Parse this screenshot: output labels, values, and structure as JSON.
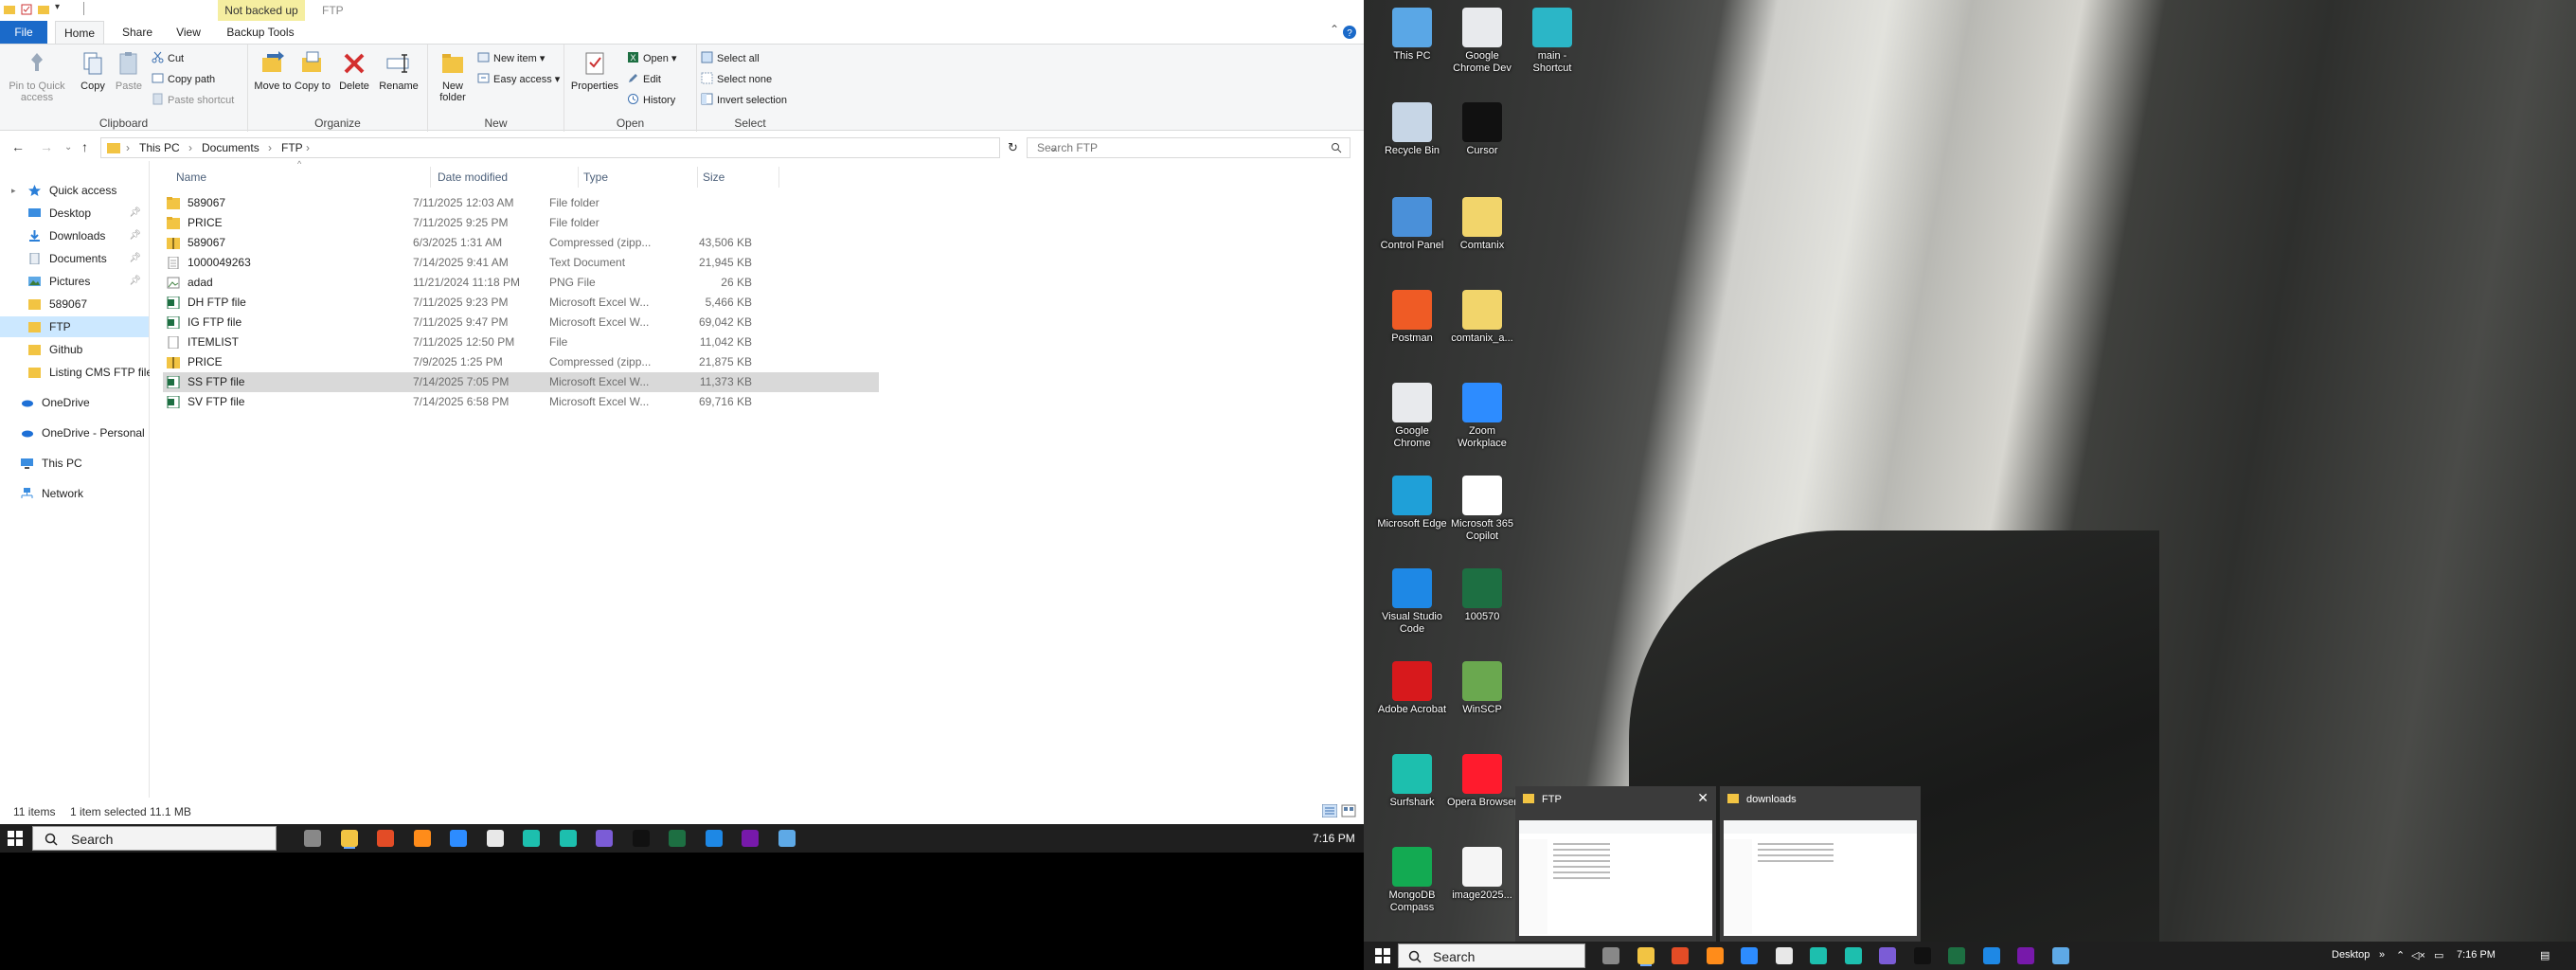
{
  "explorer": {
    "context_tab": "Not backed up",
    "title": "FTP",
    "tabs": {
      "file": "File",
      "home": "Home",
      "share": "Share",
      "view": "View",
      "backup": "Backup Tools"
    },
    "ribbon": {
      "clipboard": {
        "label": "Clipboard",
        "pin": "Pin to Quick access",
        "copy": "Copy",
        "paste": "Paste",
        "cut": "Cut",
        "copy_path": "Copy path",
        "paste_shortcut": "Paste shortcut"
      },
      "organize": {
        "label": "Organize",
        "move_to": "Move to",
        "copy_to": "Copy to",
        "delete": "Delete",
        "rename": "Rename"
      },
      "new": {
        "label": "New",
        "new_folder": "New folder",
        "new_item": "New item",
        "easy_access": "Easy access"
      },
      "open": {
        "label": "Open",
        "properties": "Properties",
        "open": "Open",
        "edit": "Edit",
        "history": "History"
      },
      "select": {
        "label": "Select",
        "select_all": "Select all",
        "select_none": "Select none",
        "invert": "Invert selection"
      }
    },
    "breadcrumb": [
      "This PC",
      "Documents",
      "FTP"
    ],
    "search_placeholder": "Search FTP",
    "nav": {
      "quick_access": "Quick access",
      "items": [
        "Desktop",
        "Downloads",
        "Documents",
        "Pictures",
        "589067",
        "FTP",
        "Github",
        "Listing CMS FTP file"
      ],
      "onedrive": "OneDrive",
      "onedrive_personal": "OneDrive - Personal",
      "this_pc": "This PC",
      "network": "Network"
    },
    "columns": {
      "name": "Name",
      "date": "Date modified",
      "type": "Type",
      "size": "Size"
    },
    "files": [
      {
        "name": "589067",
        "date": "7/11/2025 12:03 AM",
        "type": "File folder",
        "size": "",
        "icon": "folder-icon"
      },
      {
        "name": "PRICE",
        "date": "7/11/2025 9:25 PM",
        "type": "File folder",
        "size": "",
        "icon": "folder-icon"
      },
      {
        "name": "589067",
        "date": "6/3/2025 1:31 AM",
        "type": "Compressed (zipp...",
        "size": "43,506 KB",
        "icon": "zip-icon"
      },
      {
        "name": "1000049263",
        "date": "7/14/2025 9:41 AM",
        "type": "Text Document",
        "size": "21,945 KB",
        "icon": "text-file-icon"
      },
      {
        "name": "adad",
        "date": "11/21/2024 11:18 PM",
        "type": "PNG File",
        "size": "26 KB",
        "icon": "image-file-icon"
      },
      {
        "name": "DH FTP file",
        "date": "7/11/2025 9:23 PM",
        "type": "Microsoft Excel W...",
        "size": "5,466 KB",
        "icon": "excel-icon"
      },
      {
        "name": "IG FTP file",
        "date": "7/11/2025 9:47 PM",
        "type": "Microsoft Excel W...",
        "size": "69,042 KB",
        "icon": "excel-icon"
      },
      {
        "name": "ITEMLIST",
        "date": "7/11/2025 12:50 PM",
        "type": "File",
        "size": "11,042 KB",
        "icon": "blank-file-icon"
      },
      {
        "name": "PRICE",
        "date": "7/9/2025 1:25 PM",
        "type": "Compressed (zipp...",
        "size": "21,875 KB",
        "icon": "zip-icon"
      },
      {
        "name": "SS FTP file",
        "date": "7/14/2025 7:05 PM",
        "type": "Microsoft Excel W...",
        "size": "11,373 KB",
        "icon": "excel-icon"
      },
      {
        "name": "SV FTP file",
        "date": "7/14/2025 6:58 PM",
        "type": "Microsoft Excel W...",
        "size": "69,716 KB",
        "icon": "excel-icon"
      }
    ],
    "status": {
      "count": "11 items",
      "selected": "1 item selected  11.1 MB"
    }
  },
  "taskbar": {
    "search_label": "Search",
    "clock": "7:16 PM",
    "desktop_label": "Desktop"
  },
  "desktop_icons": [
    {
      "label": "This PC",
      "color": "#5aa7e6"
    },
    {
      "label": "Google Chrome Dev",
      "color": "#e8eaed"
    },
    {
      "label": "main - Shortcut",
      "color": "#2bb6c7"
    },
    {
      "label": "Recycle Bin",
      "color": "#c7d6e6"
    },
    {
      "label": "Cursor",
      "color": "#111111"
    },
    {
      "label": "Control Panel",
      "color": "#4a90d9"
    },
    {
      "label": "Comtanix",
      "color": "#f2d56b"
    },
    {
      "label": "Postman",
      "color": "#ef5b25"
    },
    {
      "label": "comtanix_a...",
      "color": "#f2d56b"
    },
    {
      "label": "Google Chrome",
      "color": "#e8eaed"
    },
    {
      "label": "Zoom Workplace",
      "color": "#2d8cff"
    },
    {
      "label": "Microsoft Edge",
      "color": "#1fa0d8"
    },
    {
      "label": "Microsoft 365 Copilot",
      "color": "#ffffff"
    },
    {
      "label": "Visual Studio Code",
      "color": "#1e88e5"
    },
    {
      "label": "100570",
      "color": "#1d6f42"
    },
    {
      "label": "Adobe Acrobat",
      "color": "#d7191c"
    },
    {
      "label": "WinSCP",
      "color": "#6aa84f"
    },
    {
      "label": "Surfshark",
      "color": "#1dbfae"
    },
    {
      "label": "Opera Browser",
      "color": "#ff1b2d"
    },
    {
      "label": "MongoDB Compass",
      "color": "#13aa52"
    },
    {
      "label": "image2025...",
      "color": "#f5f5f5"
    }
  ],
  "thumbnails": [
    {
      "title": "FTP"
    },
    {
      "title": "downloads"
    }
  ],
  "colors": {
    "accent": "#1b6ac9",
    "selected_row": "#d9d9d9",
    "nav_selected": "#cce8ff",
    "taskbar": "#1f1f1f"
  }
}
